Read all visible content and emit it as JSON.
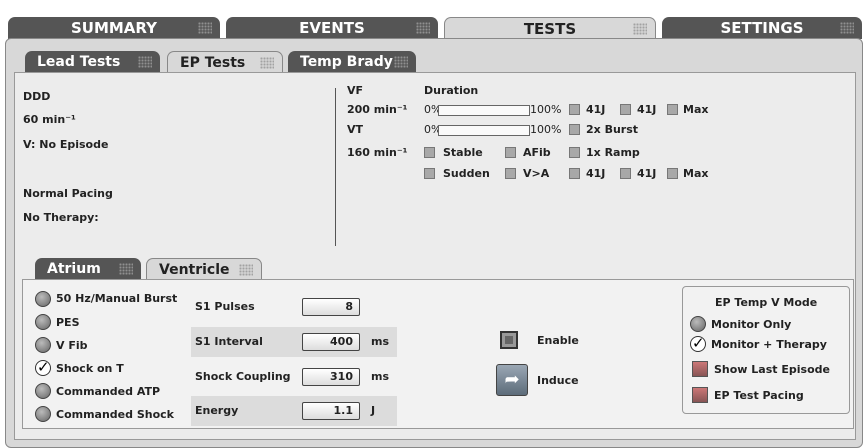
{
  "main_tabs": [
    "SUMMARY",
    "EVENTS",
    "TESTS",
    "SETTINGS"
  ],
  "sub_tabs": [
    "Lead Tests",
    "EP Tests",
    "Temp Brady"
  ],
  "left_status": {
    "mode": "DDD",
    "rate": "60 min⁻¹",
    "episode": "V: No Episode",
    "pacing": "Normal Pacing",
    "therapy": "No Therapy:"
  },
  "detection": {
    "vf_label": "VF",
    "duration_label": "Duration",
    "vf_rate": "200 min⁻¹",
    "vf_min": "0%",
    "vf_max": "100%",
    "vf_shock1": "41J",
    "vf_shock2": "41J",
    "vf_max_label": "Max",
    "vt_label": "VT",
    "vt_min": "0%",
    "vt_max": "100%",
    "vt_burst": "2x Burst",
    "vt_rate": "160 min⁻¹",
    "stable": "Stable",
    "afib": "AFib",
    "ramp": "1x Ramp",
    "sudden": "Sudden",
    "vgta": "V>A",
    "vt_shock1": "41J",
    "vt_shock2": "41J",
    "vt_max_label": "Max"
  },
  "chamber_tabs": [
    "Atrium",
    "Ventricle"
  ],
  "induction_methods": [
    "50 Hz/Manual Burst",
    "PES",
    "V Fib",
    "Shock on T",
    "Commanded ATP",
    "Commanded Shock"
  ],
  "parameters": {
    "s1_pulses_label": "S1 Pulses",
    "s1_pulses": "8",
    "s1_interval_label": "S1 Interval",
    "s1_interval": "400",
    "s1_interval_unit": "ms",
    "shock_coupling_label": "Shock Coupling",
    "shock_coupling": "310",
    "shock_coupling_unit": "ms",
    "energy_label": "Energy",
    "energy": "1.1",
    "energy_unit": "J"
  },
  "actions": {
    "enable": "Enable",
    "induce": "Induce"
  },
  "temp_mode": {
    "title": "EP Temp V Mode",
    "monitor_only": "Monitor Only",
    "monitor_therapy": "Monitor + Therapy",
    "show_last": "Show Last Episode",
    "test_pacing": "EP Test Pacing"
  }
}
